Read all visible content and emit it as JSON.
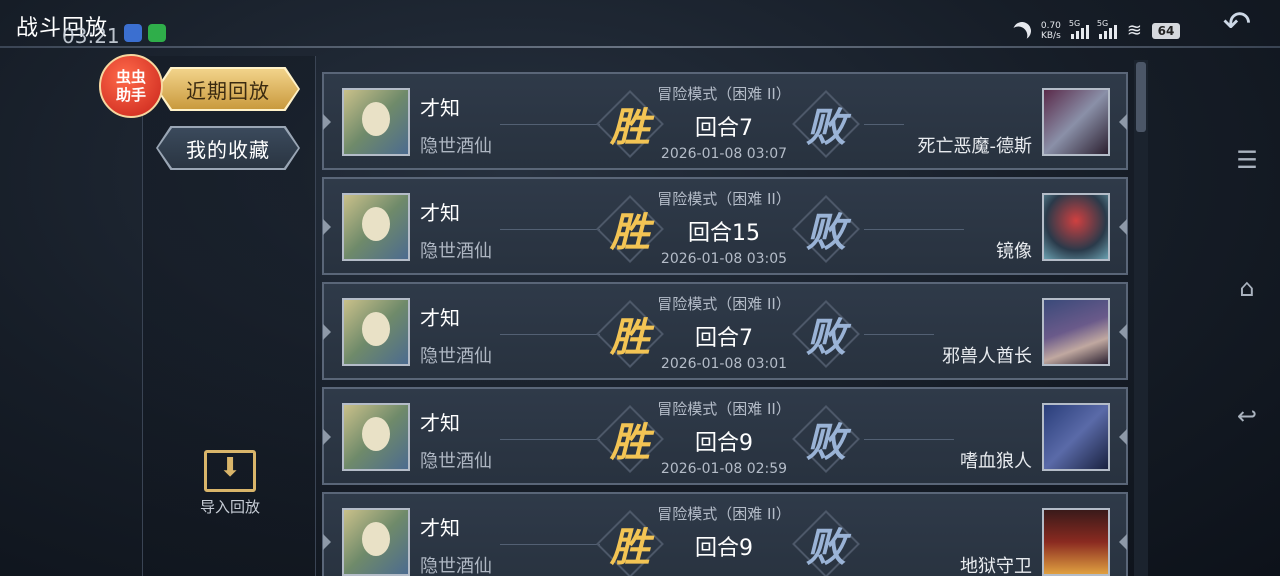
{
  "page": {
    "title": "战斗回放"
  },
  "status_bar": {
    "time": "03:21",
    "net_speed": "0.70",
    "net_unit": "KB/s",
    "sim1": "5G",
    "sim2": "5G",
    "battery": "64"
  },
  "widget": {
    "label": "虫虫助手"
  },
  "tabs": [
    {
      "label": "近期回放",
      "active": true
    },
    {
      "label": "我的收藏",
      "active": false
    }
  ],
  "import_button": {
    "label": "导入回放"
  },
  "records": [
    {
      "player_name": "才知",
      "player_title": "隐世酒仙",
      "mode": "冒险模式（困难 II）",
      "round": "回合7",
      "date": "2026-01-08 03:07",
      "win": "胜",
      "lose": "败",
      "opponent": "死亡恶魔-德斯"
    },
    {
      "player_name": "才知",
      "player_title": "隐世酒仙",
      "mode": "冒险模式（困难 II）",
      "round": "回合15",
      "date": "2026-01-08 03:05",
      "win": "胜",
      "lose": "败",
      "opponent": "镜像"
    },
    {
      "player_name": "才知",
      "player_title": "隐世酒仙",
      "mode": "冒险模式（困难 II）",
      "round": "回合7",
      "date": "2026-01-08 03:01",
      "win": "胜",
      "lose": "败",
      "opponent": "邪兽人酋长"
    },
    {
      "player_name": "才知",
      "player_title": "隐世酒仙",
      "mode": "冒险模式（困难 II）",
      "round": "回合9",
      "date": "2026-01-08 02:59",
      "win": "胜",
      "lose": "败",
      "opponent": "嗜血狼人"
    },
    {
      "player_name": "才知",
      "player_title": "隐世酒仙",
      "mode": "冒险模式（困难 II）",
      "round": "回合9",
      "date": "",
      "win": "胜",
      "lose": "败",
      "opponent": "地狱守卫"
    }
  ],
  "colors": {
    "win": "#f3c454",
    "lose": "#9ab3d6",
    "accent_gold": "#d9b56a"
  }
}
